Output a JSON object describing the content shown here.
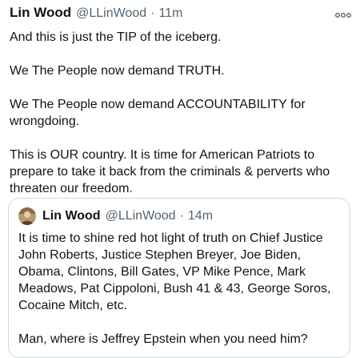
{
  "tweet": {
    "author_name": "Lin Wood",
    "handle": "@LLinWood",
    "separator": "·",
    "time": "11m",
    "more_icon": "more-horizontal-icon",
    "text": "And this is just the TIP of the iceberg.\n\nWe The People now demand TRUTH.\n\nWe The People now demand ACCOUNTABILITY for wrongdoing.\n\nThis is OUR country. It is time for American Patriots to prepare to take it back from the criminals & perverts who threaten our freedom."
  },
  "quoted_tweet": {
    "author_name": "Lin Wood",
    "handle": "@LLinWood",
    "separator": "·",
    "time": "14m",
    "text": "It is time to shine red hot light of truth on Chief Justice John Roberts, Justice Stephen Breyer, Joe Biden, Obama, Clintons, Bill Gates, VP Mike Pence, Mark Meadows, Pat Cippoloni, Bush 41 & 43, George Soros, Cocaine Mitch, etc.\n\nMan, where is Jeffrey Epstein when you need him?"
  },
  "colors": {
    "text": "#0f1419",
    "secondary": "#536471",
    "border": "#cfd9de"
  }
}
